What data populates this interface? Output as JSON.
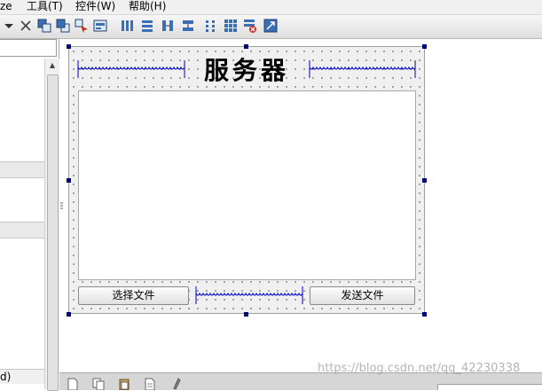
{
  "menubar": {
    "items": [
      {
        "label": "ze"
      },
      {
        "label": "工具(T)"
      },
      {
        "label": "控件(W)"
      },
      {
        "label": "帮助(H)"
      }
    ]
  },
  "left_pane": {
    "bottom_label": "d)",
    "scroll_up_glyph": "▲"
  },
  "form": {
    "title": "服务器",
    "select_file_button": "选择文件",
    "send_file_button": "发送文件"
  },
  "watermark": "https://blog.csdn.net/qq_42230338",
  "colors": {
    "selection_handle": "#000080",
    "spacer": "#0000c8",
    "canvas": "#f0f0f0"
  },
  "toolbar_icons": [
    "dropdown-arrow-icon",
    "close-icon",
    "send-to-back-icon",
    "bring-to-front-icon",
    "edit-tab-order-icon",
    "edit-buddies-icon",
    "layout-horizontal-icon",
    "layout-vertical-icon",
    "layout-h-splitter-icon",
    "layout-v-splitter-icon",
    "layout-form-icon",
    "layout-grid-icon",
    "break-layout-icon",
    "adjust-size-icon"
  ]
}
